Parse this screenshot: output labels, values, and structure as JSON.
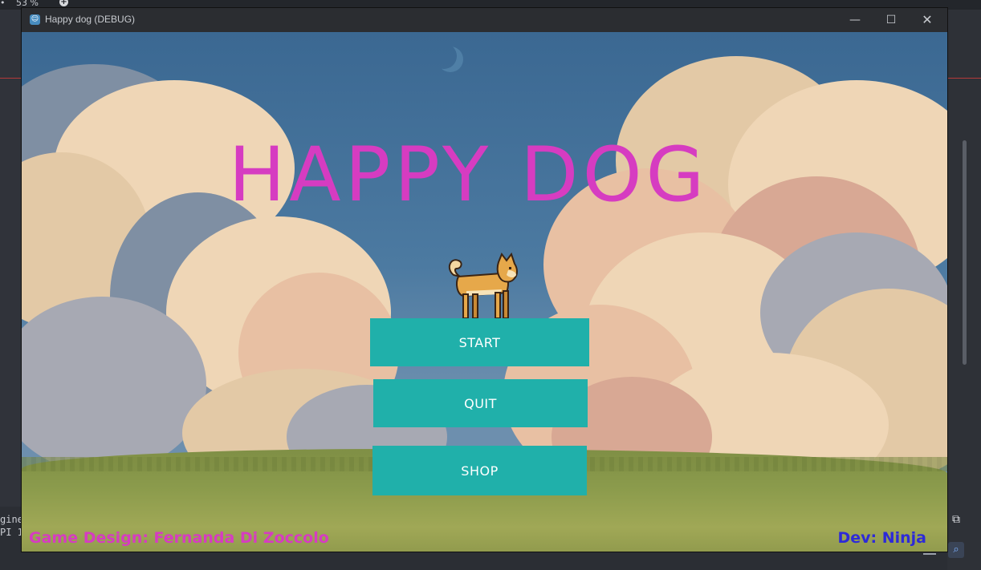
{
  "window": {
    "title": "Happy dog (DEBUG)",
    "min_glyph": "—",
    "max_glyph": "☐",
    "close_glyph": "✕"
  },
  "editor": {
    "zoom": "53 %",
    "bottom_line1": "gine",
    "bottom_line2": "PI 1"
  },
  "game": {
    "title": "HAPPY DOG",
    "buttons": {
      "start": "START",
      "quit": "QUIT",
      "shop": "SHOP"
    },
    "credits": {
      "design": "Game Design: Fernanda Di Zoccolo",
      "dev": "Dev: Ninja"
    }
  },
  "colors": {
    "title": "#d63cc1",
    "button_bg": "#20b0aa",
    "dev_credit": "#2d2ad8",
    "sky": "#3b6892"
  }
}
